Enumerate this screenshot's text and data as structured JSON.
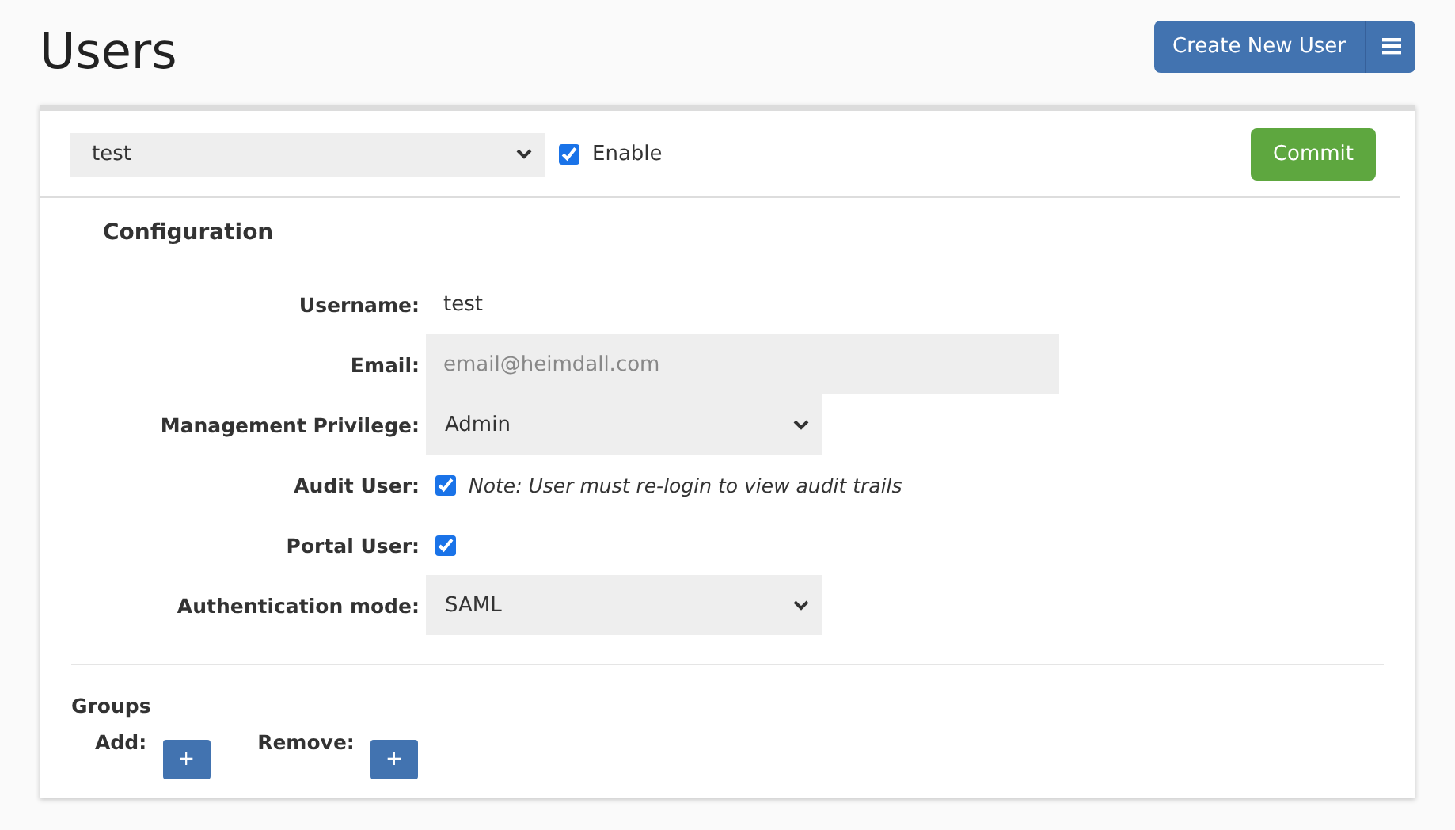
{
  "page_title": "Users",
  "create_button": "Create New User",
  "user_select": {
    "value": "test"
  },
  "enable": {
    "label": "Enable",
    "checked": true
  },
  "commit_button": "Commit",
  "section_title": "Configuration",
  "fields": [
    {
      "kind": "text",
      "label": "Username:",
      "value": "test"
    },
    {
      "kind": "input",
      "label": "Email:",
      "placeholder": "email@heimdall.com"
    },
    {
      "kind": "select",
      "label": "Management Privilege:",
      "value": "Admin"
    },
    {
      "kind": "checkbox",
      "label": "Audit User:",
      "checked": true,
      "note": "Note: User must re-login to view audit trails"
    },
    {
      "kind": "checkbox",
      "label": "Portal User:",
      "checked": true
    },
    {
      "kind": "select",
      "label": "Authentication mode:",
      "value": "SAML"
    }
  ],
  "groups": {
    "title": "Groups",
    "actions": [
      {
        "label": "Add:",
        "button": "+"
      },
      {
        "label": "Remove:",
        "button": "+"
      }
    ]
  }
}
